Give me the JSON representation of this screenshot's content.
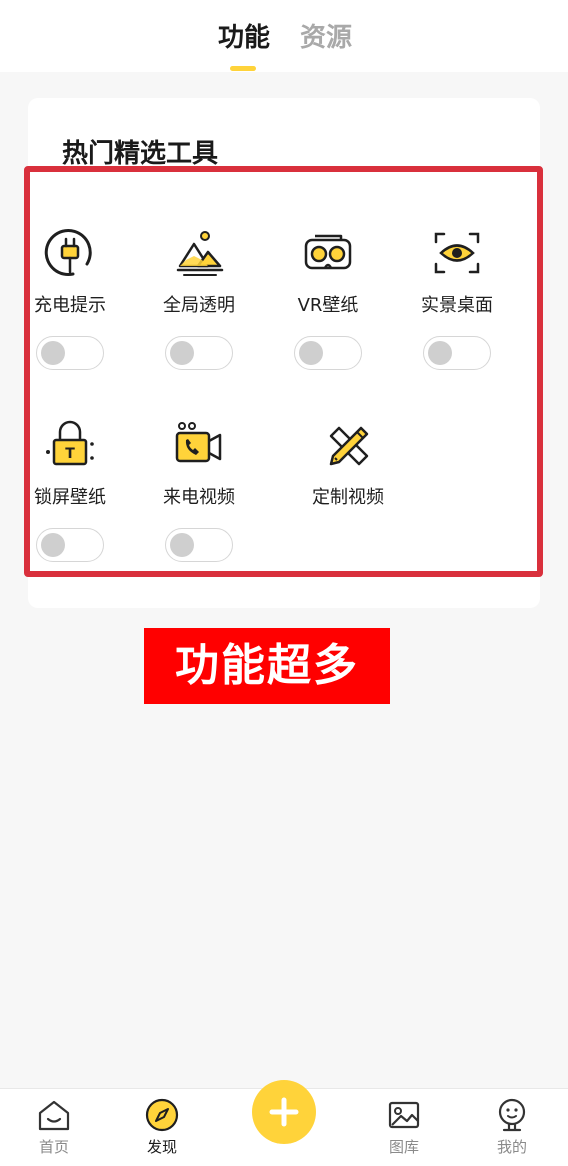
{
  "tabs": [
    {
      "label": "功能",
      "active": true
    },
    {
      "label": "资源",
      "active": false
    }
  ],
  "section_title": "热门精选工具",
  "tools": [
    {
      "label": "充电提示",
      "icon": "charging-plug-icon",
      "enabled": false
    },
    {
      "label": "全局透明",
      "icon": "landscape-transparent-icon",
      "enabled": false
    },
    {
      "label": "VR壁纸",
      "icon": "vr-headset-icon",
      "enabled": false
    },
    {
      "label": "实景桌面",
      "icon": "eye-scan-icon",
      "enabled": false
    },
    {
      "label": "锁屏壁纸",
      "icon": "lock-icon",
      "enabled": false
    },
    {
      "label": "来电视频",
      "icon": "phone-video-icon",
      "enabled": false
    },
    {
      "label": "定制视频",
      "icon": "pencil-ruler-icon",
      "has_toggle": false
    }
  ],
  "promo_text": "功能超多",
  "bottom_nav": [
    {
      "label": "首页",
      "icon": "home-icon",
      "active": false
    },
    {
      "label": "发现",
      "icon": "compass-icon",
      "active": true
    },
    {
      "label": "图库",
      "icon": "gallery-icon",
      "active": false
    },
    {
      "label": "我的",
      "icon": "profile-face-icon",
      "active": false
    }
  ],
  "fab": {
    "icon": "plus-icon"
  },
  "colors": {
    "accent_yellow": "#ffd33a",
    "highlight_red": "#d9303c",
    "promo_red": "#ff0000",
    "background": "#f7f7f7"
  }
}
